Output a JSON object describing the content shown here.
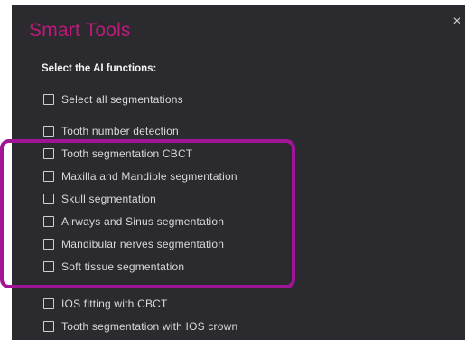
{
  "dialog": {
    "title": "Smart Tools",
    "close_glyph": "×",
    "subtitle": "Select the AI functions:",
    "accent_color": "#c0187a",
    "highlight_color": "#a01595",
    "background_color": "#2b2b2f"
  },
  "options": [
    {
      "label": "Select all segmentations",
      "checked": false
    },
    {
      "label": "Tooth number detection",
      "checked": false
    },
    {
      "label": "Tooth segmentation CBCT",
      "checked": false
    },
    {
      "label": "Maxilla and Mandible segmentation",
      "checked": false
    },
    {
      "label": "Skull segmentation",
      "checked": false
    },
    {
      "label": "Airways and Sinus segmentation",
      "checked": false
    },
    {
      "label": "Mandibular nerves segmentation",
      "checked": false
    },
    {
      "label": "Soft tissue segmentation",
      "checked": false
    },
    {
      "label": "IOS fitting with CBCT",
      "checked": false
    },
    {
      "label": "Tooth segmentation with IOS crown",
      "checked": false
    }
  ]
}
